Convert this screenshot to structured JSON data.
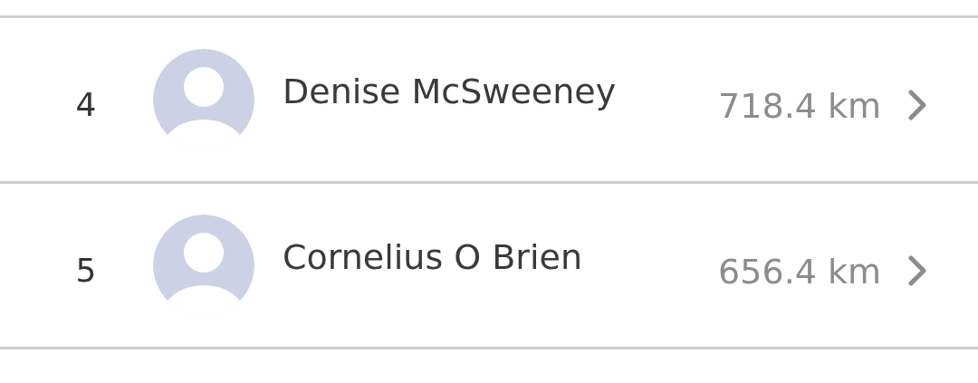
{
  "rows": [
    {
      "rank": "4",
      "name": "Denise McSweeney",
      "distance": "718.4 km"
    },
    {
      "rank": "5",
      "name": "Cornelius O Brien",
      "distance": "656.4 km"
    }
  ]
}
